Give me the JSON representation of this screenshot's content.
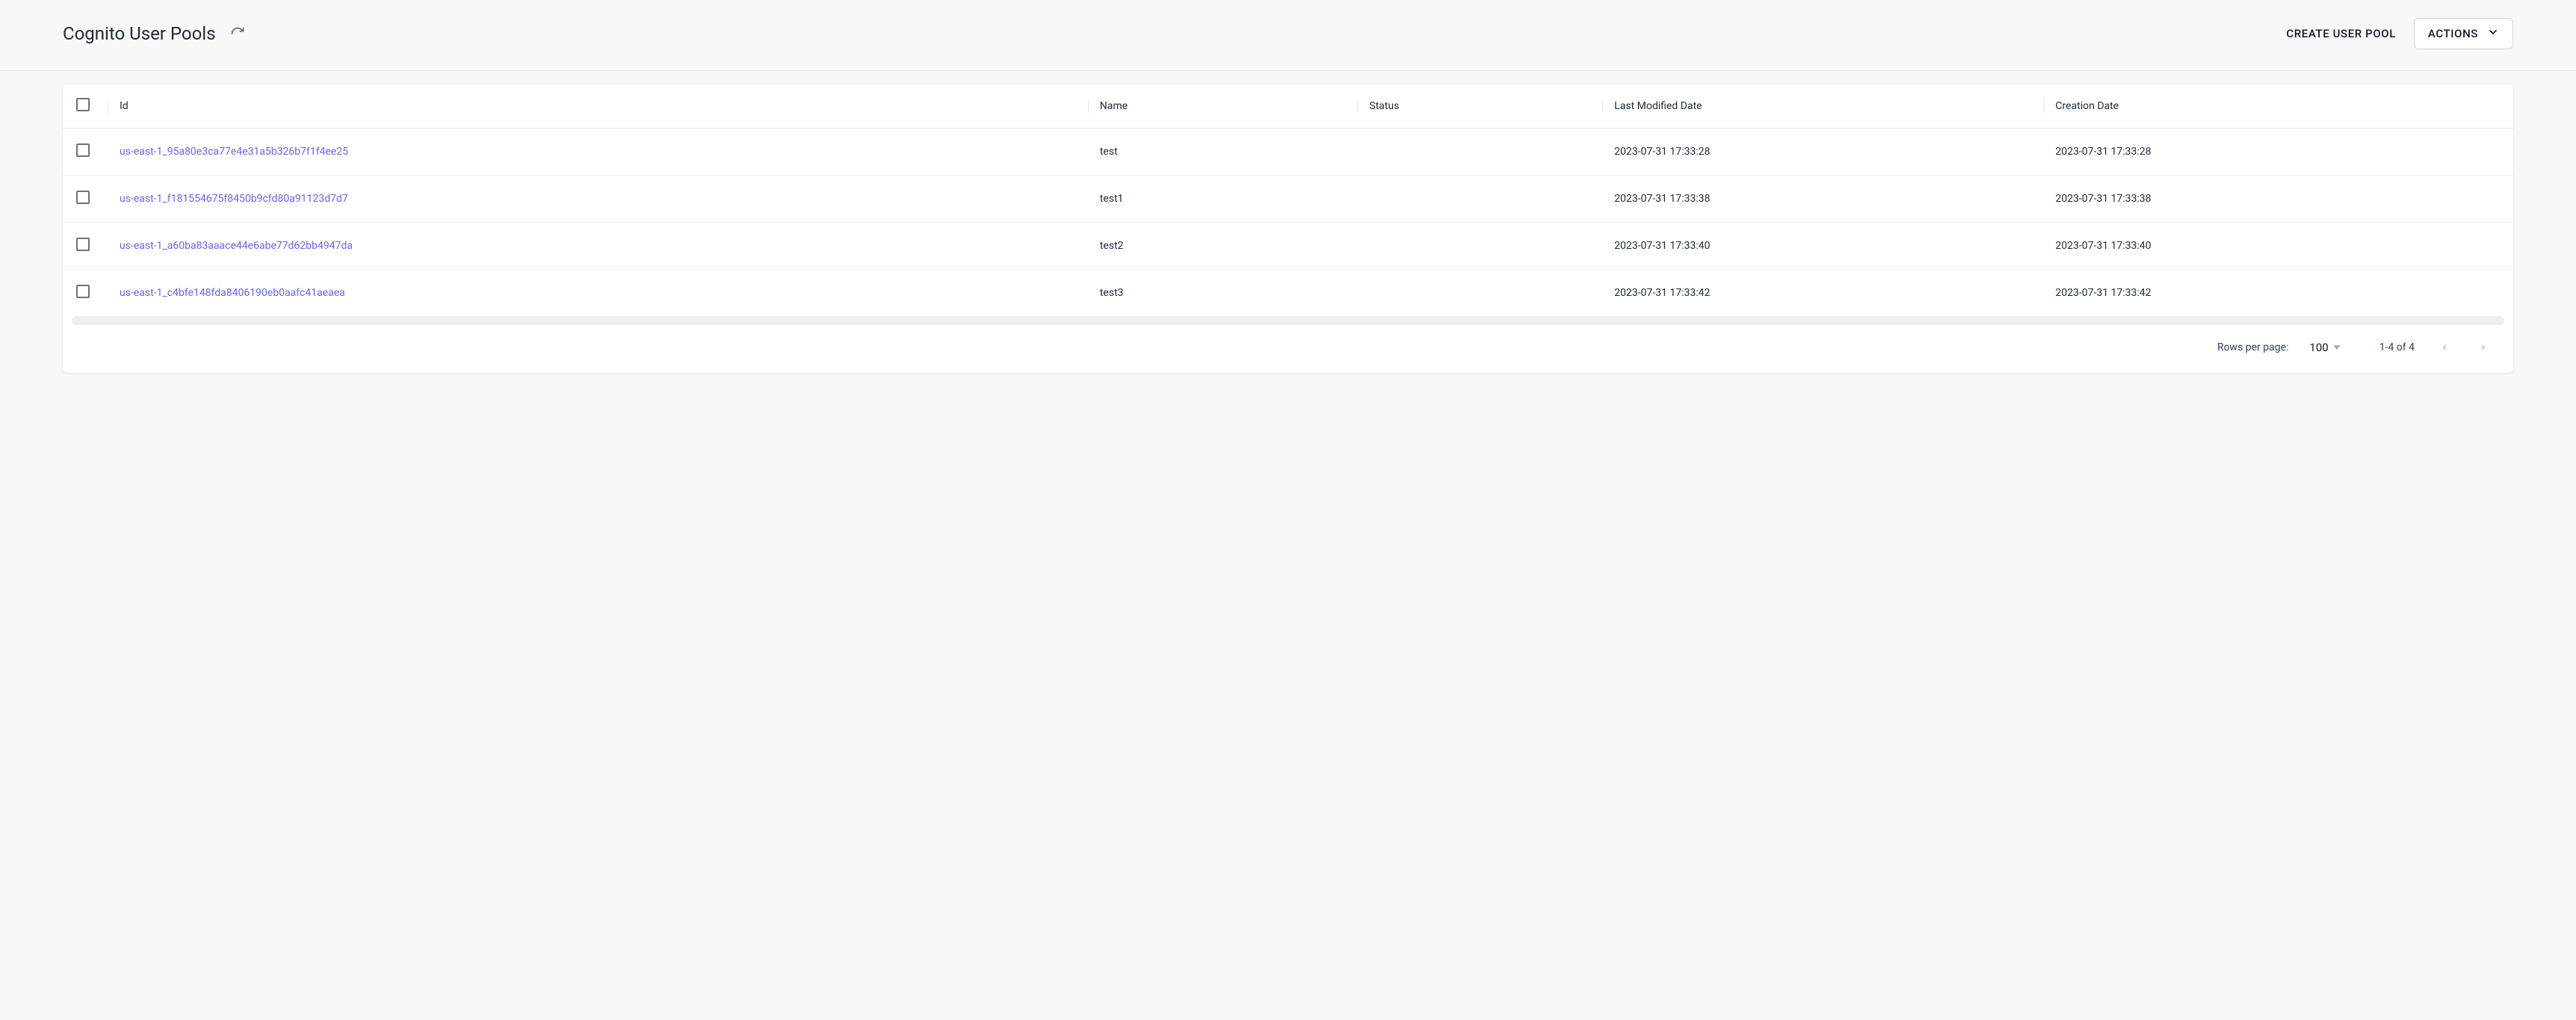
{
  "header": {
    "title": "Cognito User Pools",
    "create_label": "CREATE USER POOL",
    "actions_label": "ACTIONS"
  },
  "table": {
    "columns": {
      "id": "Id",
      "name": "Name",
      "status": "Status",
      "last_modified": "Last Modified Date",
      "creation": "Creation Date"
    },
    "rows": [
      {
        "id": "us-east-1_95a80e3ca77e4e31a5b326b7f1f4ee25",
        "name": "test",
        "status": "",
        "last_modified": "2023-07-31 17:33:28",
        "creation": "2023-07-31 17:33:28"
      },
      {
        "id": "us-east-1_f181554675f8450b9cfd80a91123d7d7",
        "name": "test1",
        "status": "",
        "last_modified": "2023-07-31 17:33:38",
        "creation": "2023-07-31 17:33:38"
      },
      {
        "id": "us-east-1_a60ba83aaace44e6abe77d62bb4947da",
        "name": "test2",
        "status": "",
        "last_modified": "2023-07-31 17:33:40",
        "creation": "2023-07-31 17:33:40"
      },
      {
        "id": "us-east-1_c4bfe148fda8406190eb0aafc41aeaea",
        "name": "test3",
        "status": "",
        "last_modified": "2023-07-31 17:33:42",
        "creation": "2023-07-31 17:33:42"
      }
    ]
  },
  "pagination": {
    "rows_label": "Rows per page:",
    "rows_value": "100",
    "range_text": "1-4 of 4"
  }
}
